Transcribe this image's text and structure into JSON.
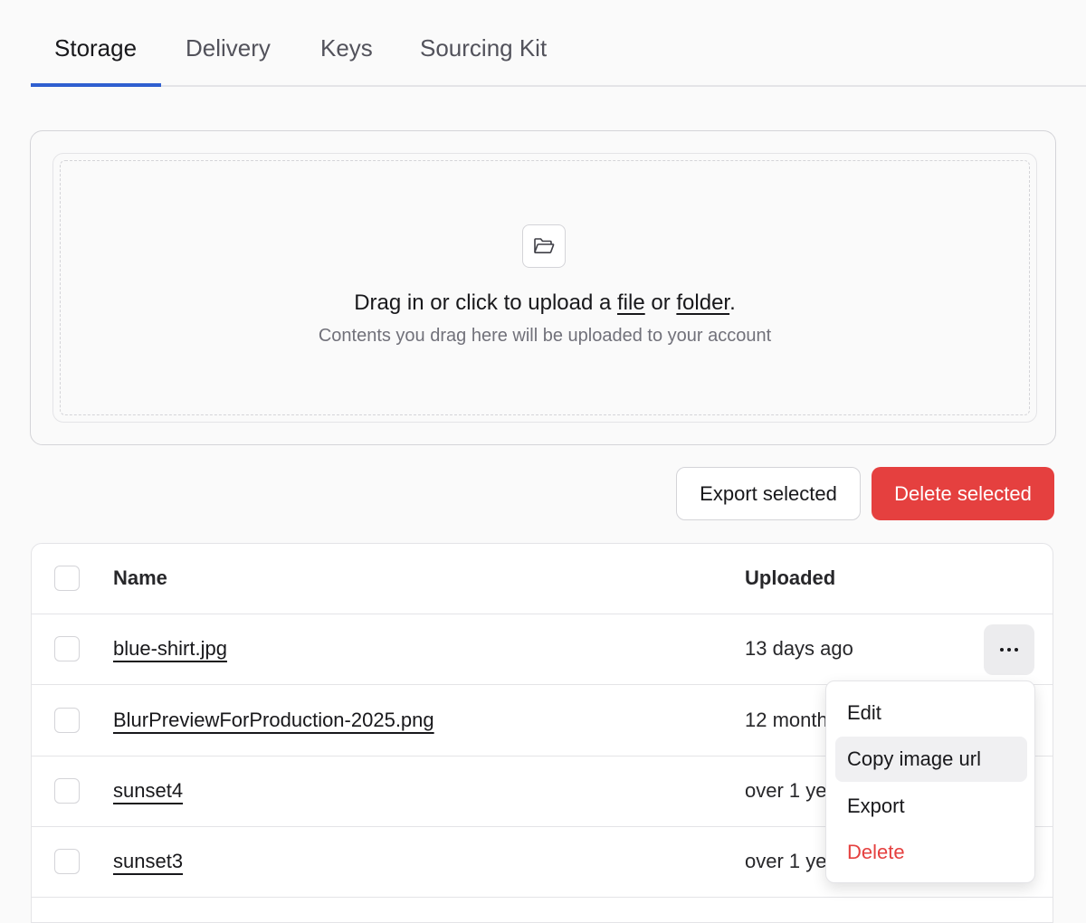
{
  "tabs": [
    {
      "label": "Storage",
      "active": true
    },
    {
      "label": "Delivery",
      "active": false
    },
    {
      "label": "Keys",
      "active": false
    },
    {
      "label": "Sourcing Kit",
      "active": false
    }
  ],
  "upload": {
    "title_prefix": "Drag in or click to upload a ",
    "file_link": "file",
    "title_mid": " or ",
    "folder_link": "folder",
    "title_suffix": ".",
    "subtitle": "Contents you drag here will be uploaded to your account"
  },
  "actions": {
    "export_label": "Export selected",
    "delete_label": "Delete selected"
  },
  "table": {
    "headers": {
      "name": "Name",
      "uploaded": "Uploaded"
    },
    "rows": [
      {
        "name": "blue-shirt.jpg",
        "uploaded": "13 days ago"
      },
      {
        "name": "BlurPreviewForProduction-2025.png",
        "uploaded": "12 month"
      },
      {
        "name": "sunset4",
        "uploaded": "over 1 ye"
      },
      {
        "name": "sunset3",
        "uploaded": "over 1 ye"
      }
    ]
  },
  "menu": {
    "items": [
      {
        "label": "Edit"
      },
      {
        "label": "Copy image url"
      },
      {
        "label": "Export"
      },
      {
        "label": "Delete"
      }
    ]
  },
  "colors": {
    "accent": "#2f5fd0",
    "danger": "#e5403f"
  }
}
